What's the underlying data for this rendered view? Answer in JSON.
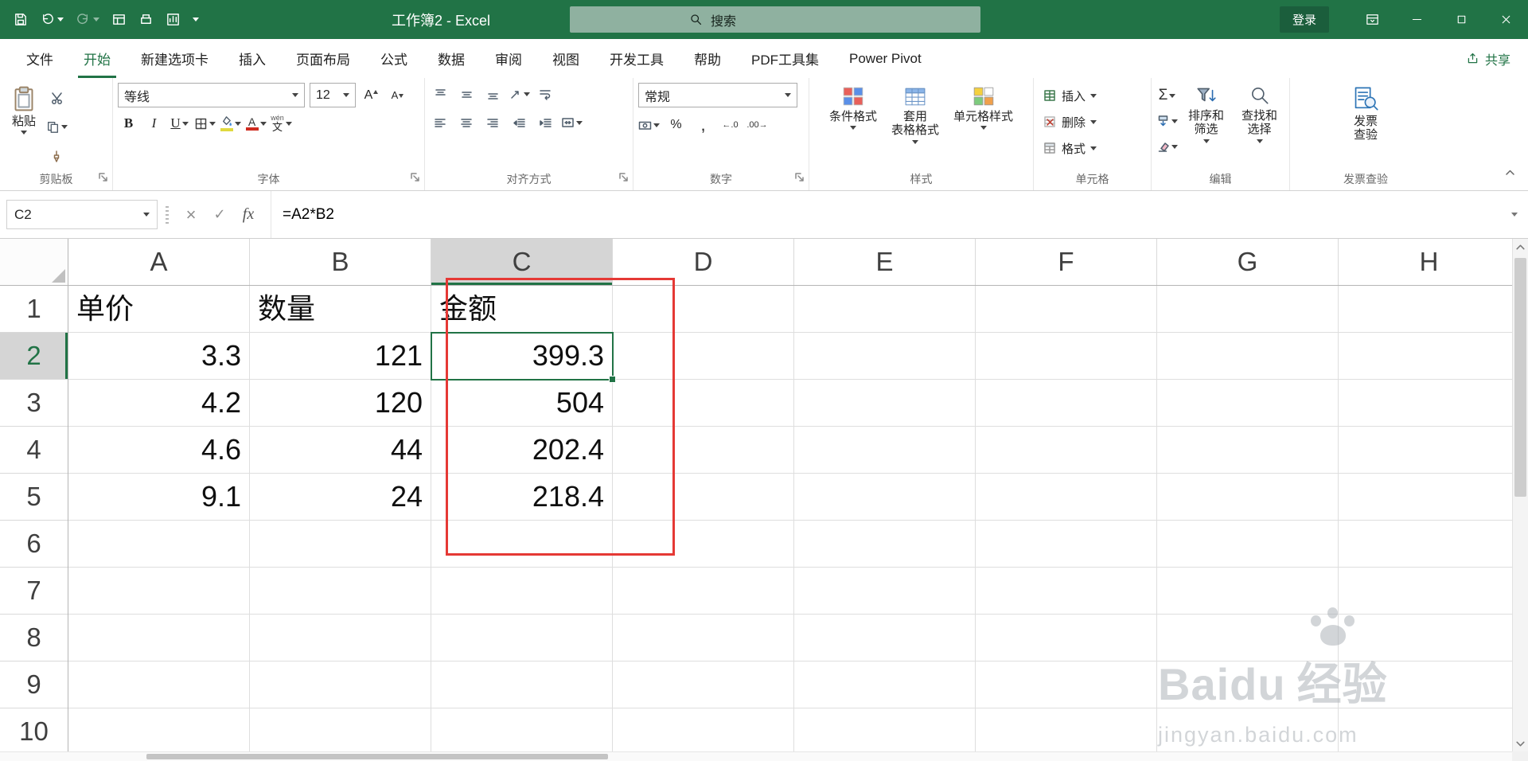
{
  "title_bar": {
    "title": "工作簿2 - Excel",
    "search_placeholder": "搜索",
    "login_label": "登录"
  },
  "tabs": {
    "items": [
      "文件",
      "开始",
      "新建选项卡",
      "插入",
      "页面布局",
      "公式",
      "数据",
      "审阅",
      "视图",
      "开发工具",
      "帮助",
      "PDF工具集",
      "Power Pivot"
    ],
    "selected": "开始",
    "share_label": "共享"
  },
  "ribbon": {
    "clipboard": {
      "label": "剪贴板",
      "paste": "粘贴"
    },
    "font": {
      "label": "字体",
      "name": "等线",
      "size": "12",
      "bold": "B",
      "italic": "I",
      "underline": "U",
      "phonetic_pinyin": "wén",
      "phonetic_char": "文"
    },
    "alignment": {
      "label": "对齐方式"
    },
    "number": {
      "label": "数字",
      "format": "常规",
      "percent": "%",
      "comma": ",",
      "increase_decimal": "←.0",
      "decrease_decimal": ".00→"
    },
    "styles": {
      "label": "样式",
      "conditional": "条件格式",
      "table_line1": "套用",
      "table_line2": "表格格式",
      "cell_styles": "单元格样式"
    },
    "cells": {
      "label": "单元格",
      "insert": "插入",
      "delete": "删除",
      "format": "格式"
    },
    "editing": {
      "label": "编辑",
      "autosum": "Σ",
      "sort_filter": "排序和筛选",
      "find_select": "查找和选择"
    },
    "invoice": {
      "label": "发票查验",
      "line1": "发票",
      "line2": "查验"
    }
  },
  "formula_bar": {
    "name_box": "C2",
    "cancel": "×",
    "enter": "✓",
    "fx": "fx",
    "formula": "=A2*B2"
  },
  "grid": {
    "col_headers": [
      "A",
      "B",
      "C",
      "D",
      "E",
      "F",
      "G",
      "H"
    ],
    "row_headers": [
      "1",
      "2",
      "3",
      "4",
      "5",
      "6",
      "7",
      "8",
      "9",
      "10"
    ],
    "cells": [
      {
        "r": "1",
        "c": "A",
        "v": "单价",
        "align": "left"
      },
      {
        "r": "1",
        "c": "B",
        "v": "数量",
        "align": "left"
      },
      {
        "r": "1",
        "c": "C",
        "v": "金额",
        "align": "left"
      },
      {
        "r": "2",
        "c": "A",
        "v": "3.3",
        "align": "right"
      },
      {
        "r": "2",
        "c": "B",
        "v": "121",
        "align": "right"
      },
      {
        "r": "2",
        "c": "C",
        "v": "399.3",
        "align": "right"
      },
      {
        "r": "3",
        "c": "A",
        "v": "4.2",
        "align": "right"
      },
      {
        "r": "3",
        "c": "B",
        "v": "120",
        "align": "right"
      },
      {
        "r": "3",
        "c": "C",
        "v": "504",
        "align": "right"
      },
      {
        "r": "4",
        "c": "A",
        "v": "4.6",
        "align": "right"
      },
      {
        "r": "4",
        "c": "B",
        "v": "44",
        "align": "right"
      },
      {
        "r": "4",
        "c": "C",
        "v": "202.4",
        "align": "right"
      },
      {
        "r": "5",
        "c": "A",
        "v": "9.1",
        "align": "right"
      },
      {
        "r": "5",
        "c": "B",
        "v": "24",
        "align": "right"
      },
      {
        "r": "5",
        "c": "C",
        "v": "218.4",
        "align": "right"
      }
    ],
    "selection": {
      "cell": "C2",
      "column": "C",
      "row": "2"
    }
  },
  "watermark": {
    "brand": "Baidu",
    "suffix": "经验",
    "url": "jingyan.baidu.com"
  },
  "colors": {
    "accent": "#217346",
    "annotation": "#e53935",
    "title_bar": "#217346"
  }
}
